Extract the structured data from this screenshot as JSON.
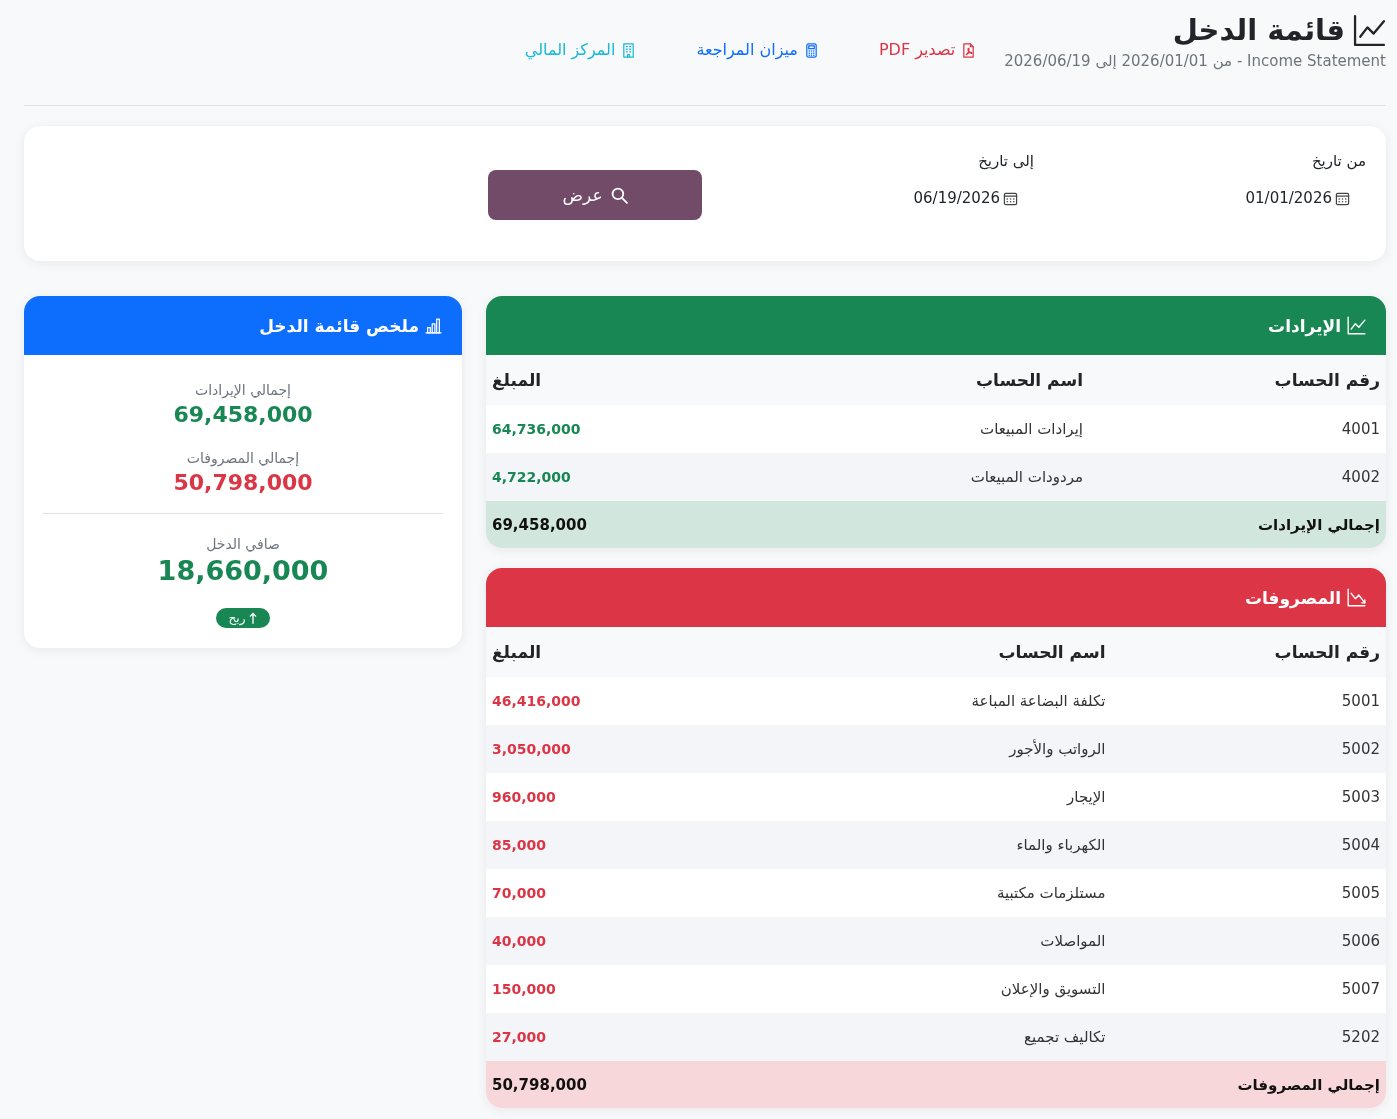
{
  "header": {
    "title": "قائمة الدخل",
    "subtitle": "Income Statement - من 2026/01/01 إلى 2026/06/19",
    "actions": [
      {
        "kind": "pdf",
        "label": "تصدير PDF"
      },
      {
        "kind": "trial_balance",
        "label": "ميزان المراجعة"
      },
      {
        "kind": "financial_position",
        "label": "المركز المالي"
      }
    ]
  },
  "filter": {
    "fields": [
      {
        "label": "من تاريخ",
        "value": "01/01/2026"
      },
      {
        "label": "إلى تاريخ",
        "value": "06/19/2026"
      }
    ],
    "button": "عرض"
  },
  "sections": [
    {
      "kind": "revenue",
      "title": "الإيرادات",
      "columns": [
        "رقم الحساب",
        "اسم الحساب",
        "المبلغ"
      ],
      "rows": [
        {
          "number": "4001",
          "name": "إيرادات المبيعات",
          "amount": "64,736,000"
        },
        {
          "number": "4002",
          "name": "مردودات المبيعات",
          "amount": "4,722,000"
        }
      ],
      "total": {
        "label": "إجمالي الإيرادات",
        "amount": "69,458,000"
      }
    },
    {
      "kind": "expense",
      "title": "المصروفات",
      "columns": [
        "رقم الحساب",
        "اسم الحساب",
        "المبلغ"
      ],
      "rows": [
        {
          "number": "5001",
          "name": "تكلفة البضاعة المباعة",
          "amount": "46,416,000"
        },
        {
          "number": "5002",
          "name": "الرواتب والأجور",
          "amount": "3,050,000"
        },
        {
          "number": "5003",
          "name": "الإيجار",
          "amount": "960,000"
        },
        {
          "number": "5004",
          "name": "الكهرباء والماء",
          "amount": "85,000"
        },
        {
          "number": "5005",
          "name": "مستلزمات مكتبية",
          "amount": "70,000"
        },
        {
          "number": "5006",
          "name": "المواصلات",
          "amount": "40,000"
        },
        {
          "number": "5007",
          "name": "التسويق والإعلان",
          "amount": "150,000"
        },
        {
          "number": "5202",
          "name": "تكاليف تجميع",
          "amount": "27,000"
        }
      ],
      "total": {
        "label": "إجمالي المصروفات",
        "amount": "50,798,000"
      }
    }
  ],
  "summary": {
    "title": "ملخص قائمة الدخل",
    "items": [
      {
        "kind": "revenue",
        "label": "إجمالي الإيرادات",
        "value": "69,458,000"
      },
      {
        "kind": "expense",
        "label": "إجمالي المصروفات",
        "value": "50,798,000"
      }
    ],
    "net": {
      "kind": "profit",
      "label": "صافي الدخل",
      "value": "18,660,000",
      "badge": "ربح"
    }
  }
}
